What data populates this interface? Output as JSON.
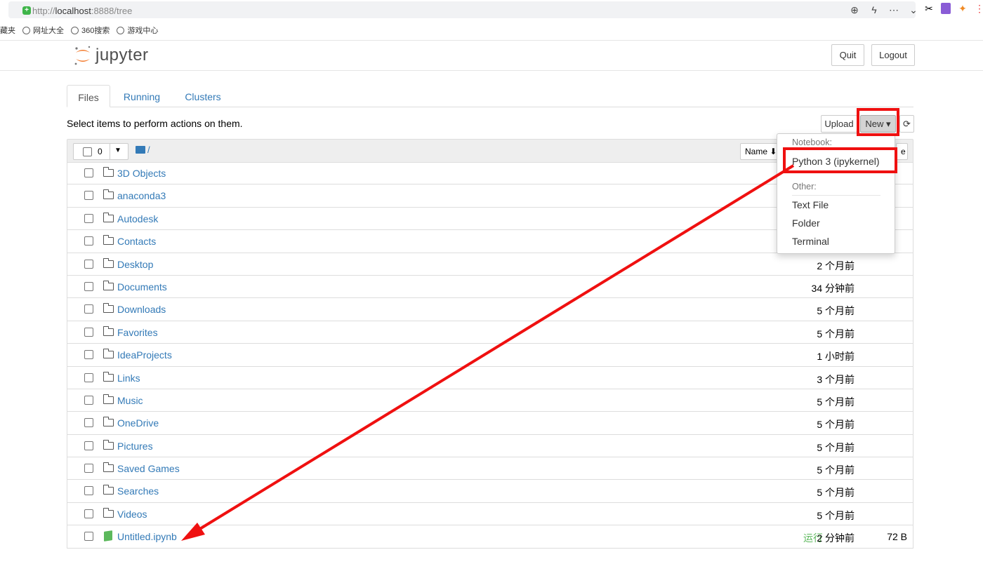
{
  "browser": {
    "url_prefix": "http://",
    "url_host": "localhost",
    "url_rest": ":8888/tree",
    "bookmarks": [
      "藏夹",
      "网址大全",
      "360搜索",
      "游戏中心"
    ]
  },
  "header": {
    "logo_text": "jupyter",
    "quit_label": "Quit",
    "logout_label": "Logout"
  },
  "tabs": [
    {
      "label": "Files",
      "active": true
    },
    {
      "label": "Running",
      "active": false
    },
    {
      "label": "Clusters",
      "active": false
    }
  ],
  "toolbar": {
    "hint": "Select items to perform actions on them.",
    "upload_label": "Upload",
    "new_label": "New ▾",
    "selected_count": "0",
    "breadcrumb": "/",
    "sort_name_label": "Name ⬇",
    "sort_last_label": "e"
  },
  "new_menu": {
    "notebook_header": "Notebook:",
    "python_kernel": "Python 3 (ipykernel)",
    "other_header": "Other:",
    "text_file": "Text File",
    "folder": "Folder",
    "terminal": "Terminal"
  },
  "files": [
    {
      "name": "3D Objects",
      "type": "folder",
      "modified": "",
      "size": "",
      "status": ""
    },
    {
      "name": "anaconda3",
      "type": "folder",
      "modified": "",
      "size": "",
      "status": ""
    },
    {
      "name": "Autodesk",
      "type": "folder",
      "modified": "",
      "size": "",
      "status": ""
    },
    {
      "name": "Contacts",
      "type": "folder",
      "modified": "",
      "size": "",
      "status": ""
    },
    {
      "name": "Desktop",
      "type": "folder",
      "modified": "2 个月前",
      "size": "",
      "status": ""
    },
    {
      "name": "Documents",
      "type": "folder",
      "modified": "34 分钟前",
      "size": "",
      "status": ""
    },
    {
      "name": "Downloads",
      "type": "folder",
      "modified": "5 个月前",
      "size": "",
      "status": ""
    },
    {
      "name": "Favorites",
      "type": "folder",
      "modified": "5 个月前",
      "size": "",
      "status": ""
    },
    {
      "name": "IdeaProjects",
      "type": "folder",
      "modified": "1 小时前",
      "size": "",
      "status": ""
    },
    {
      "name": "Links",
      "type": "folder",
      "modified": "3 个月前",
      "size": "",
      "status": ""
    },
    {
      "name": "Music",
      "type": "folder",
      "modified": "5 个月前",
      "size": "",
      "status": ""
    },
    {
      "name": "OneDrive",
      "type": "folder",
      "modified": "5 个月前",
      "size": "",
      "status": ""
    },
    {
      "name": "Pictures",
      "type": "folder",
      "modified": "5 个月前",
      "size": "",
      "status": ""
    },
    {
      "name": "Saved Games",
      "type": "folder",
      "modified": "5 个月前",
      "size": "",
      "status": ""
    },
    {
      "name": "Searches",
      "type": "folder",
      "modified": "5 个月前",
      "size": "",
      "status": ""
    },
    {
      "name": "Videos",
      "type": "folder",
      "modified": "5 个月前",
      "size": "",
      "status": ""
    },
    {
      "name": "Untitled.ipynb",
      "type": "notebook",
      "modified": "2 分钟前",
      "size": "72 B",
      "status": "运行"
    }
  ],
  "annotation": {
    "color": "#ef1010"
  }
}
